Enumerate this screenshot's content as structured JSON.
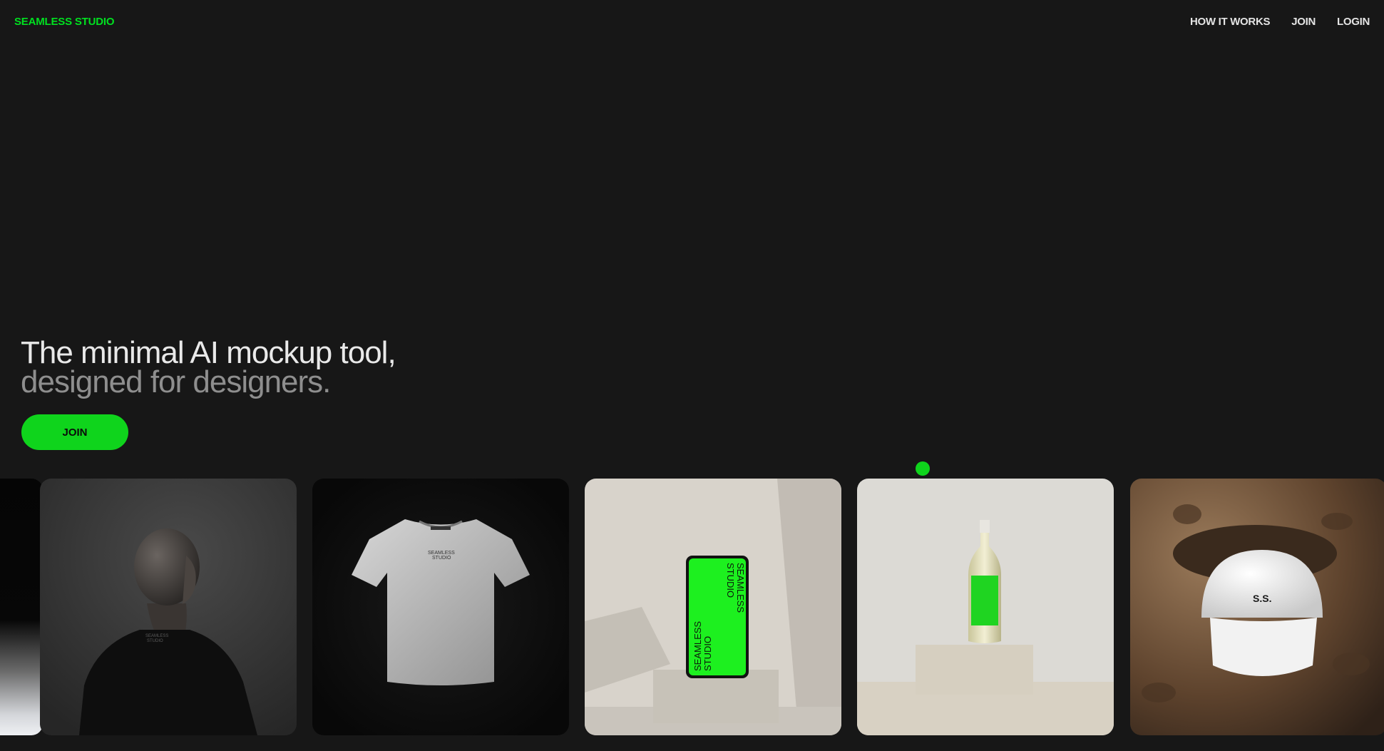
{
  "header": {
    "brand": "SEAMLESS STUDIO",
    "nav": {
      "how_it_works": "HOW IT WORKS",
      "join": "JOIN",
      "login": "LOGIN"
    }
  },
  "hero": {
    "headline_line1": "The minimal AI mockup tool,",
    "headline_line2": "designed for designers.",
    "cta_label": "JOIN"
  },
  "mockups": {
    "jacket": {
      "print_line1": "SEAMLESS",
      "print_line2": "STUDIO"
    },
    "tshirt": {
      "print_line1": "SEAMLESS",
      "print_line2": "STUDIO"
    },
    "phone": {
      "text_line1": "SEAMLESS",
      "text_line2": "STUDIO"
    },
    "cap": {
      "embroidery": "S.S."
    }
  },
  "colors": {
    "accent": "#0fd41c",
    "brand_text": "#00e020",
    "background": "#171717"
  }
}
